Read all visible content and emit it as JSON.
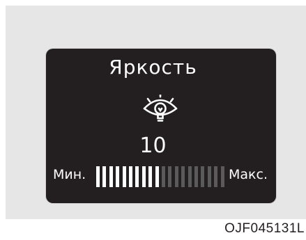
{
  "display": {
    "title": "Яркость",
    "value": "10",
    "min_label": "Мин.",
    "max_label": "Макс.",
    "icon": "brightness-lamp-icon",
    "level": {
      "current": 10,
      "segments": 20
    },
    "colors": {
      "screen": "#231f20",
      "segment_on": "#ffffff",
      "segment_off": "#5a5a5a",
      "panel": "#e6e6e6"
    }
  },
  "figure_code": "OJF045131L"
}
